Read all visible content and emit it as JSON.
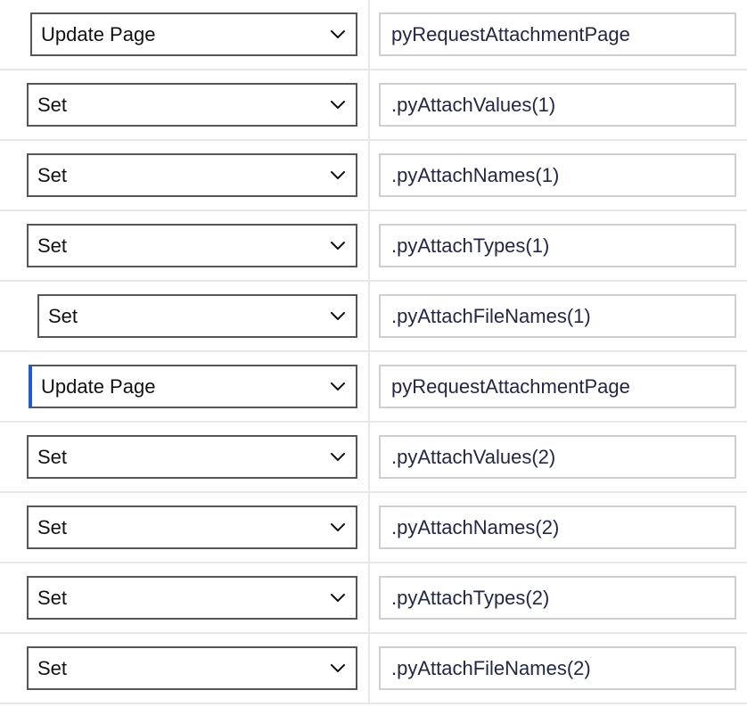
{
  "rows": [
    {
      "action": "Update Page",
      "target": "pyRequestAttachmentPage",
      "active": false
    },
    {
      "action": "Set",
      "target": ".pyAttachValues(1)",
      "active": false
    },
    {
      "action": "Set",
      "target": ".pyAttachNames(1)",
      "active": false
    },
    {
      "action": "Set",
      "target": ".pyAttachTypes(1)",
      "active": false
    },
    {
      "action": "Set",
      "target": ".pyAttachFileNames(1)",
      "active": false
    },
    {
      "action": "Update Page",
      "target": "pyRequestAttachmentPage",
      "active": true
    },
    {
      "action": "Set",
      "target": ".pyAttachValues(2)",
      "active": false
    },
    {
      "action": "Set",
      "target": ".pyAttachNames(2)",
      "active": false
    },
    {
      "action": "Set",
      "target": ".pyAttachTypes(2)",
      "active": false
    },
    {
      "action": "Set",
      "target": ".pyAttachFileNames(2)",
      "active": false
    }
  ]
}
